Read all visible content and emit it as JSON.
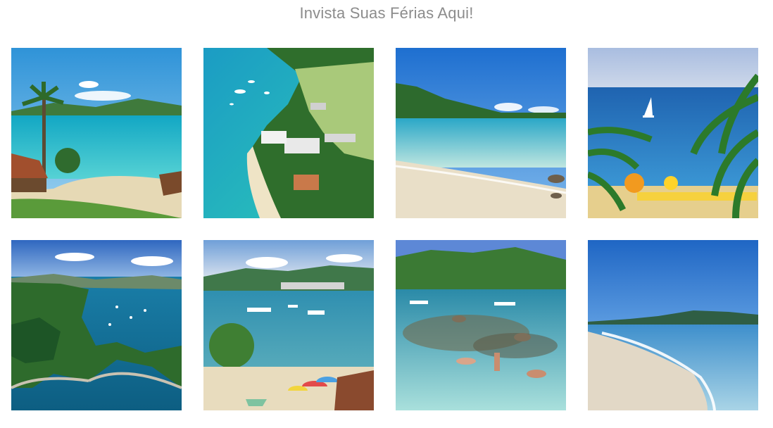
{
  "page": {
    "title": "Invista Suas Férias Aqui!"
  },
  "gallery": {
    "photos": [
      {
        "scene": "tropical-beach-with-palm-and-huts"
      },
      {
        "scene": "aerial-peninsula-with-boats"
      },
      {
        "scene": "calm-beach-shoreline"
      },
      {
        "scene": "sailboat-and-palm-fronds"
      },
      {
        "scene": "aerial-bay-with-coastline"
      },
      {
        "scene": "bay-with-boats-and-umbrellas"
      },
      {
        "scene": "clear-water-swimmers"
      },
      {
        "scene": "empty-beach-shore"
      }
    ]
  },
  "colors": {
    "title": "#8c8c8c",
    "sky": "#4a8fd6",
    "sea": "#1fa3b8",
    "sand": "#e8dcc3",
    "forest": "#2f6b2e"
  }
}
